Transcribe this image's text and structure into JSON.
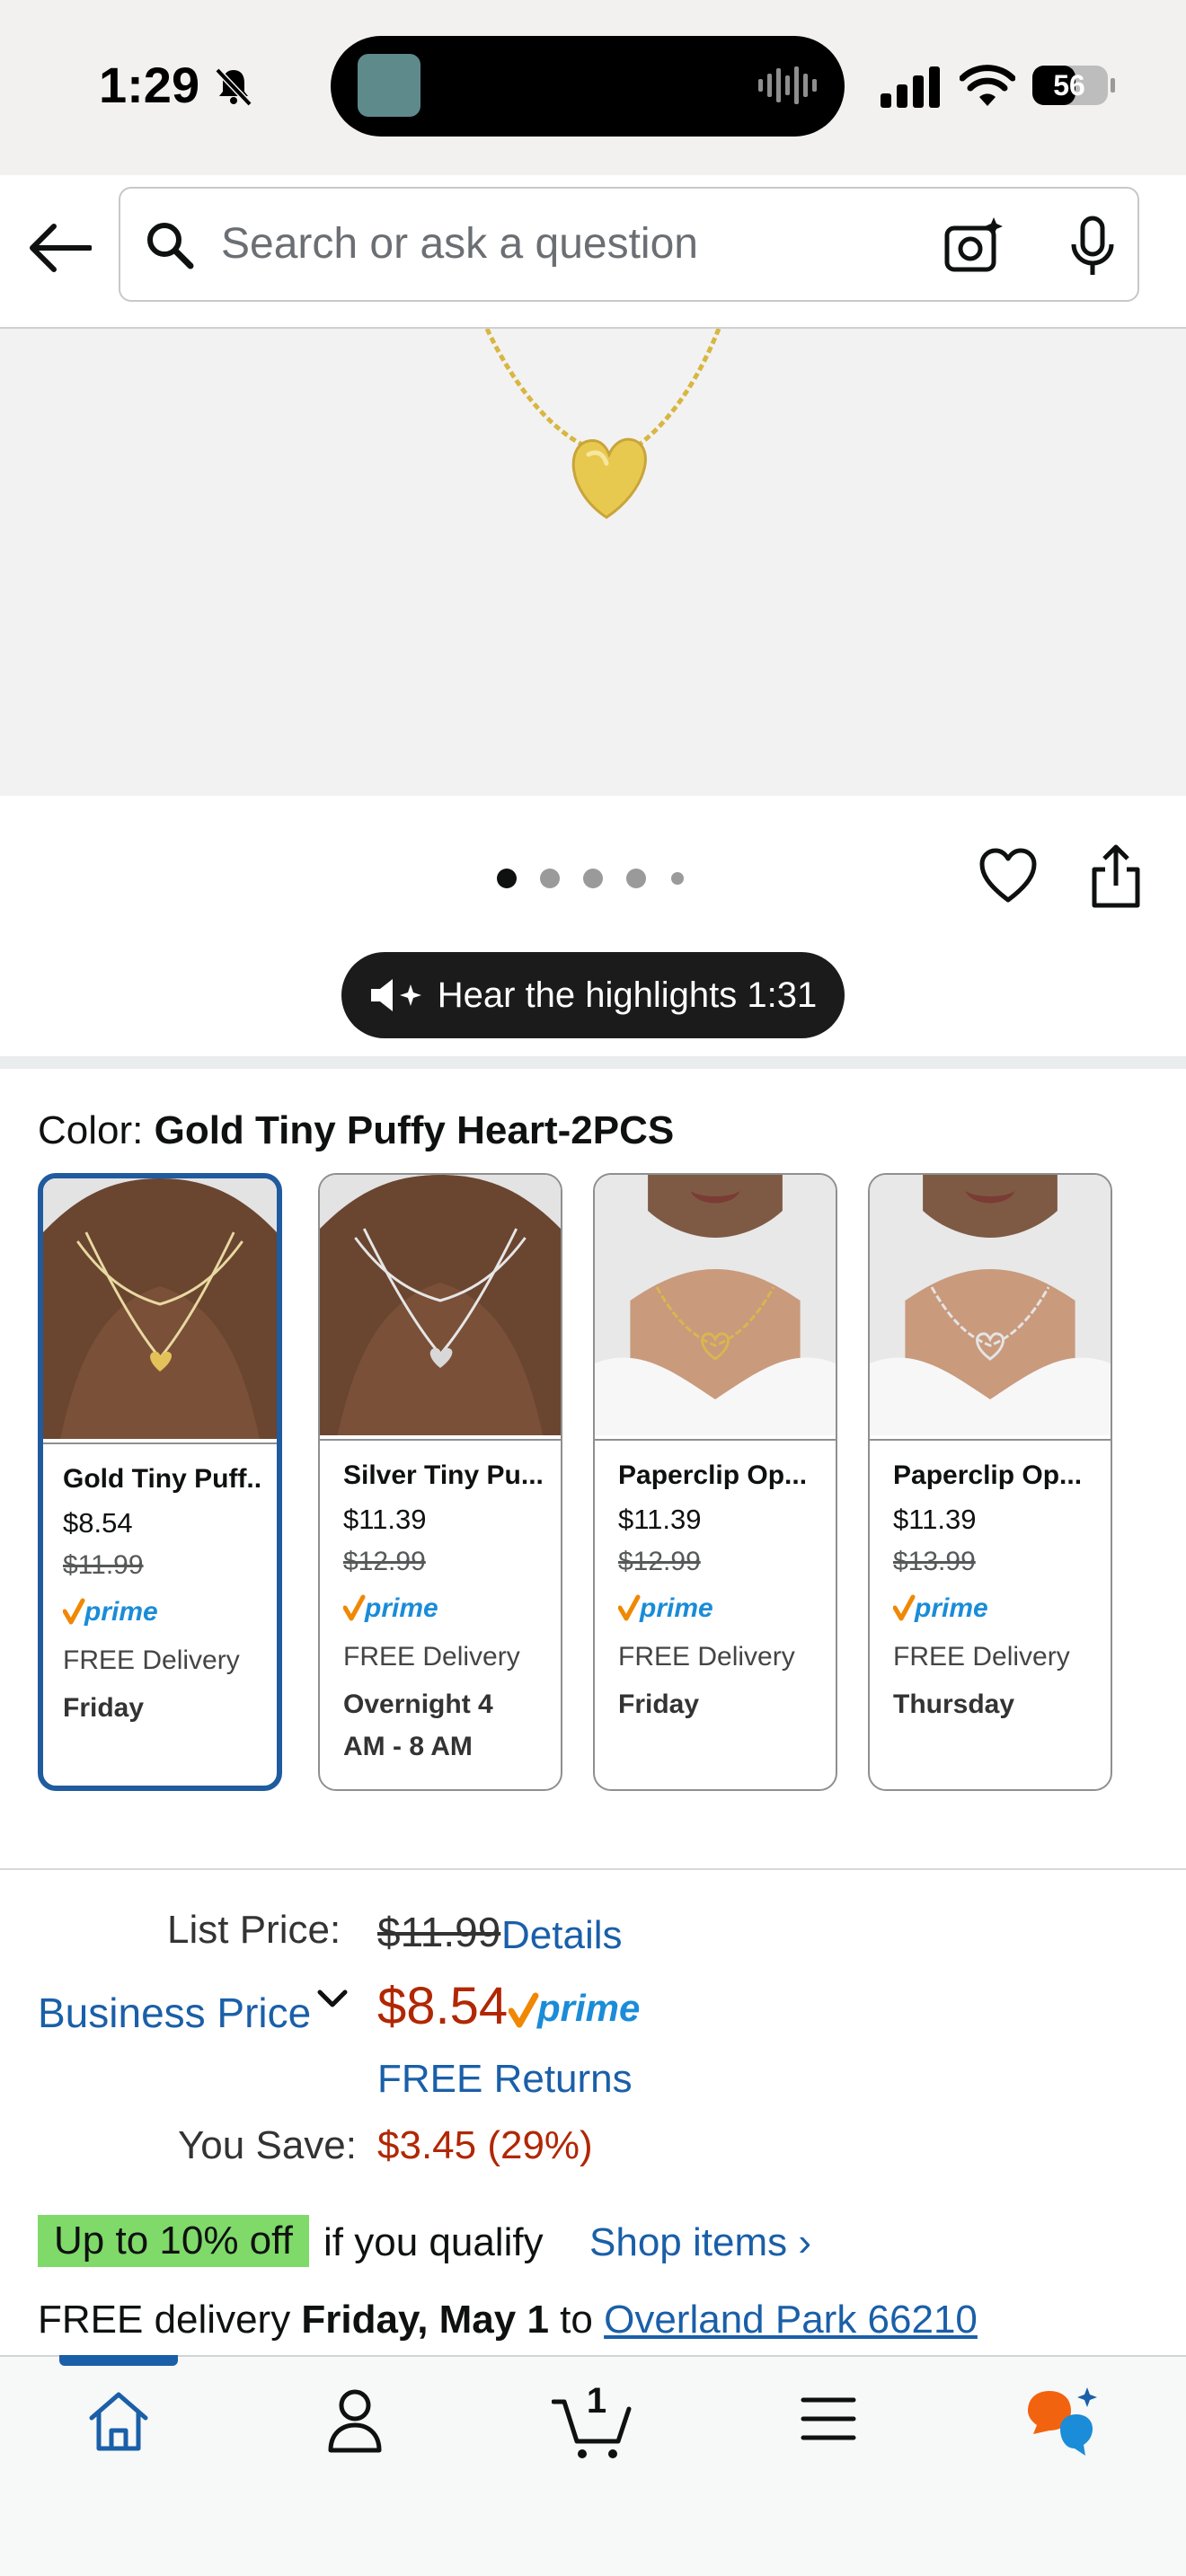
{
  "status_bar": {
    "time": "1:29",
    "battery": "56"
  },
  "search": {
    "placeholder": "Search or ask a question"
  },
  "hear": {
    "label": "Hear the highlights 1:31"
  },
  "color": {
    "label": "Color: ",
    "value": "Gold Tiny Puffy Heart-2PCS"
  },
  "swatches": [
    {
      "name": "Gold Tiny Puff..",
      "price": "$8.54",
      "old_price": "$11.99",
      "prime": "prime",
      "delivery": "FREE Delivery",
      "day": "Friday",
      "selected": true
    },
    {
      "name": "Silver Tiny Pu...",
      "price": "$11.39",
      "old_price": "$12.99",
      "prime": "prime",
      "delivery": "FREE Delivery",
      "day": "Overnight 4 AM - 8 AM",
      "selected": false
    },
    {
      "name": "Paperclip Op...",
      "price": "$11.39",
      "old_price": "$12.99",
      "prime": "prime",
      "delivery": "FREE Delivery",
      "day": "Friday",
      "selected": false
    },
    {
      "name": "Paperclip Op...",
      "price": "$11.39",
      "old_price": "$13.99",
      "prime": "prime",
      "delivery": "FREE Delivery",
      "day": "Thursday",
      "selected": false
    }
  ],
  "pricing": {
    "list_label": "List Price:",
    "list_value": "$11.99",
    "details": "Details",
    "business_price": "Business Price",
    "price": "$8.54",
    "prime": "prime",
    "free_returns": "FREE Returns",
    "save_label": "You Save:",
    "save_value": "$3.45 (29%)"
  },
  "deal": {
    "badge": "Up to 10% off",
    "text": "if you qualify",
    "link": "Shop items ›"
  },
  "delivery": {
    "prefix": "FREE delivery ",
    "date": "Friday, May 1",
    "to": " to ",
    "location": "Overland Park 66210"
  },
  "nav": {
    "cart_count": "1"
  },
  "colors": {
    "link": "#1a5fa8",
    "price_red": "#b12704",
    "selected_border": "#1f5b9e",
    "deal_green": "#7fda69"
  }
}
